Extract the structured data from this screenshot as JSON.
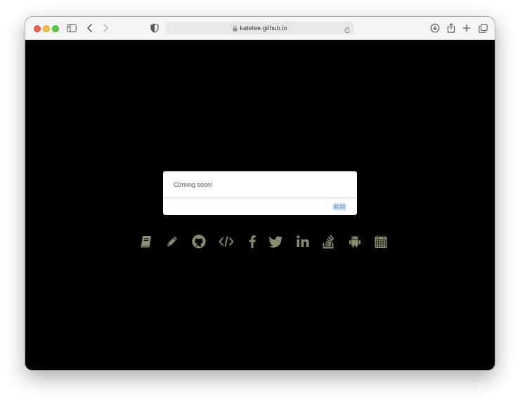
{
  "browser": {
    "url": "katelee.github.io"
  },
  "dialog": {
    "message": "Coming soon!",
    "close_label": "關閉"
  },
  "social_icons": [
    "book-icon",
    "pencil-icon",
    "github-icon",
    "code-icon",
    "facebook-icon",
    "twitter-icon",
    "linkedin-icon",
    "stackoverflow-icon",
    "android-icon",
    "calendar-icon"
  ],
  "colors": {
    "icon": "#8a8a6e",
    "background": "#000000",
    "link": "#3d87d8"
  }
}
